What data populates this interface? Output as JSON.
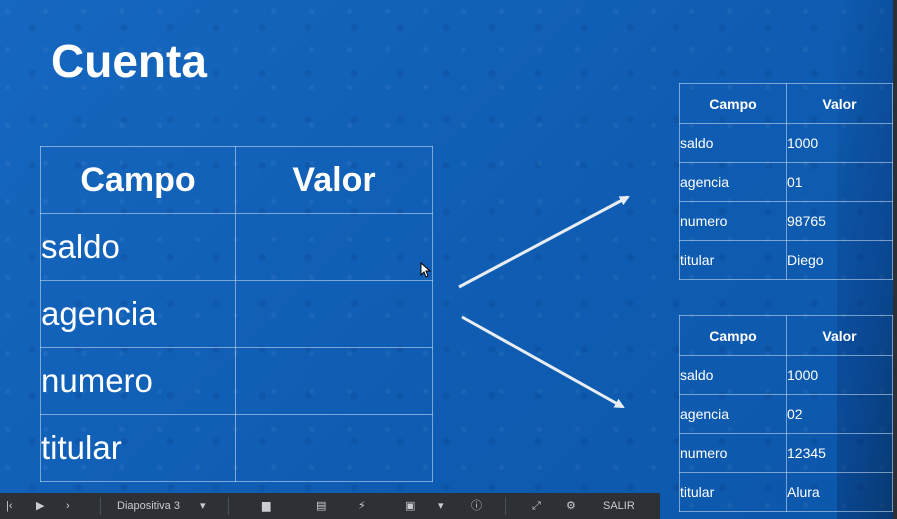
{
  "slide": {
    "title": "Cuenta",
    "main_table": {
      "headers": [
        "Campo",
        "Valor"
      ],
      "rows": [
        {
          "campo": "saldo",
          "valor": ""
        },
        {
          "campo": "agencia",
          "valor": ""
        },
        {
          "campo": "numero",
          "valor": ""
        },
        {
          "campo": "titular",
          "valor": ""
        }
      ]
    },
    "instance_tables": [
      {
        "headers": [
          "Campo",
          "Valor"
        ],
        "rows": [
          {
            "campo": "saldo",
            "valor": "1000"
          },
          {
            "campo": "agencia",
            "valor": "01"
          },
          {
            "campo": "numero",
            "valor": "98765"
          },
          {
            "campo": "titular",
            "valor": "Diego"
          }
        ]
      },
      {
        "headers": [
          "Campo",
          "Valor"
        ],
        "rows": [
          {
            "campo": "saldo",
            "valor": "1000"
          },
          {
            "campo": "agencia",
            "valor": "02"
          },
          {
            "campo": "numero",
            "valor": "12345"
          },
          {
            "campo": "titular",
            "valor": "Alura"
          }
        ]
      }
    ]
  },
  "toolbar": {
    "slide_label": "Diapositiva 3",
    "exit_label": "SALIR",
    "icons": [
      "first-slide-icon",
      "previous-slide-icon",
      "next-slide-icon",
      "slide-menu-icon",
      "comments-icon",
      "notes-icon",
      "flash-icon",
      "captions-icon",
      "info-icon",
      "fullscreen-icon",
      "settings-icon"
    ]
  },
  "colors": {
    "background": "#0f5fb6",
    "text": "#ffffff",
    "toolbar": "#2d3135"
  }
}
